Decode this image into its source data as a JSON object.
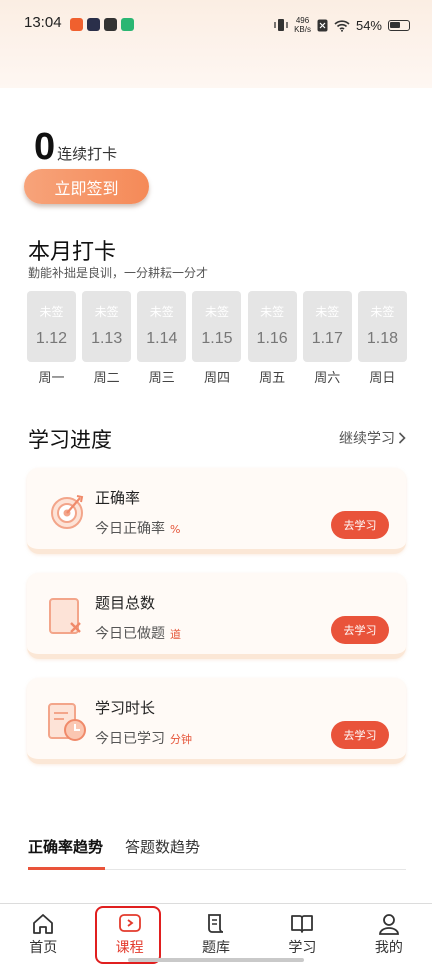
{
  "status_bar": {
    "time": "13:04",
    "net_speed_top": "496",
    "net_speed_bottom": "KB/s",
    "battery": "54%"
  },
  "checkin": {
    "streak_count": "0",
    "streak_label": "连续打卡",
    "button": "立即签到"
  },
  "month": {
    "title": "本月打卡",
    "subtitle": "勤能补拙是良训，一分耕耘一分才",
    "days": [
      {
        "status": "未签",
        "date": "1.12",
        "weekday": "周一"
      },
      {
        "status": "未签",
        "date": "1.13",
        "weekday": "周二"
      },
      {
        "status": "未签",
        "date": "1.14",
        "weekday": "周三"
      },
      {
        "status": "未签",
        "date": "1.15",
        "weekday": "周四"
      },
      {
        "status": "未签",
        "date": "1.16",
        "weekday": "周五"
      },
      {
        "status": "未签",
        "date": "1.17",
        "weekday": "周六"
      },
      {
        "status": "未签",
        "date": "1.18",
        "weekday": "周日"
      }
    ]
  },
  "progress": {
    "title": "学习进度",
    "link": "继续学习",
    "cards": [
      {
        "icon": "target-icon",
        "title": "正确率",
        "sub": "今日正确率",
        "unit": "%",
        "button": "去学习"
      },
      {
        "icon": "question-bank-icon",
        "title": "题目总数",
        "sub": "今日已做题",
        "unit": "道",
        "button": "去学习"
      },
      {
        "icon": "study-time-icon",
        "title": "学习时长",
        "sub": "今日已学习",
        "unit": "分钟",
        "button": "去学习"
      }
    ]
  },
  "trends": {
    "tabs": [
      "正确率趋势",
      "答题数趋势"
    ]
  },
  "tabbar": {
    "items": [
      {
        "label": "首页",
        "icon": "home-icon"
      },
      {
        "label": "课程",
        "icon": "course-icon"
      },
      {
        "label": "题库",
        "icon": "question-bank-icon"
      },
      {
        "label": "学习",
        "icon": "book-icon"
      },
      {
        "label": "我的",
        "icon": "profile-icon"
      }
    ],
    "active_index": 1
  },
  "colors": {
    "accent": "#e9533a",
    "button_gradient_start": "#f7a37a",
    "button_gradient_end": "#f58a58",
    "active_tab": "#e33a2c"
  }
}
